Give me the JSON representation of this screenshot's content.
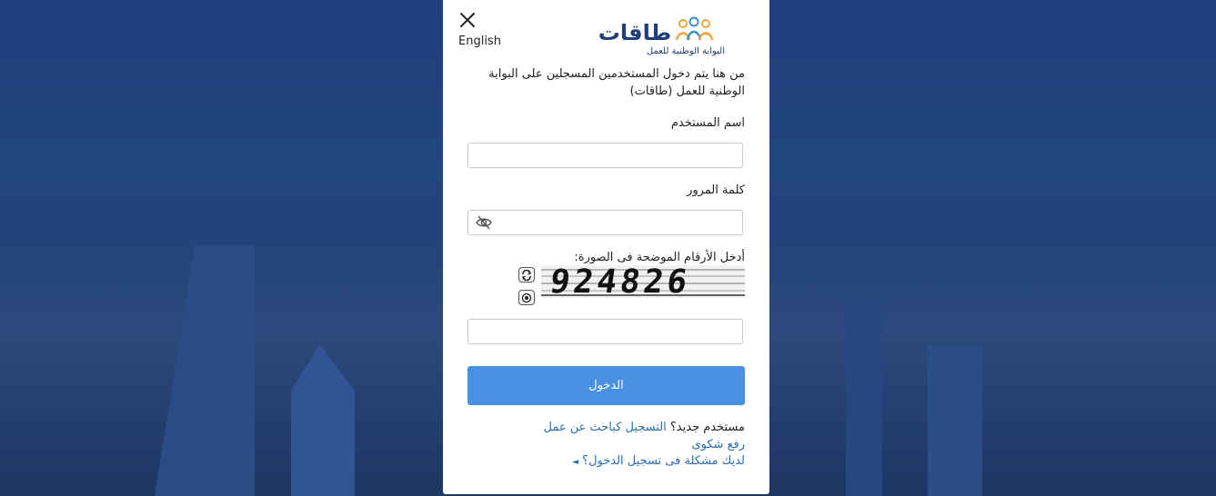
{
  "lang_toggle": "English",
  "logo": {
    "name": "طاقات",
    "tagline": "البوابة الوطنية للعمل"
  },
  "intro_text": "من هنا يتم دخول المستخدمين المسجلين على البوابة الوطنية للعمل (طاقات)",
  "username": {
    "label": "اسم المستخدم",
    "value": ""
  },
  "password": {
    "label": "كلمة المرور",
    "value": ""
  },
  "captcha": {
    "label": "أدخل الأرقام الموضحة فى الصورة:",
    "image_text": "924826",
    "value": ""
  },
  "login_button": "الدخول",
  "footer": {
    "new_user_prefix": "مستخدم جديد؟",
    "register_link": "التسجيل كباحث عن عمل",
    "complaint_link": "رفع شكوى",
    "problem_link": "لديك مشكلة فى تسجيل الدخول؟",
    "problem_arrow": "◄"
  },
  "colors": {
    "brand_navy": "#1f3f7a",
    "button_blue": "#4a90e2",
    "link_blue": "#2a6db3",
    "logo_orange": "#f0a53a",
    "logo_blue": "#3a8fd6"
  },
  "icons": [
    "close-icon",
    "eye-slash-icon",
    "refresh-icon",
    "audio-icon"
  ]
}
